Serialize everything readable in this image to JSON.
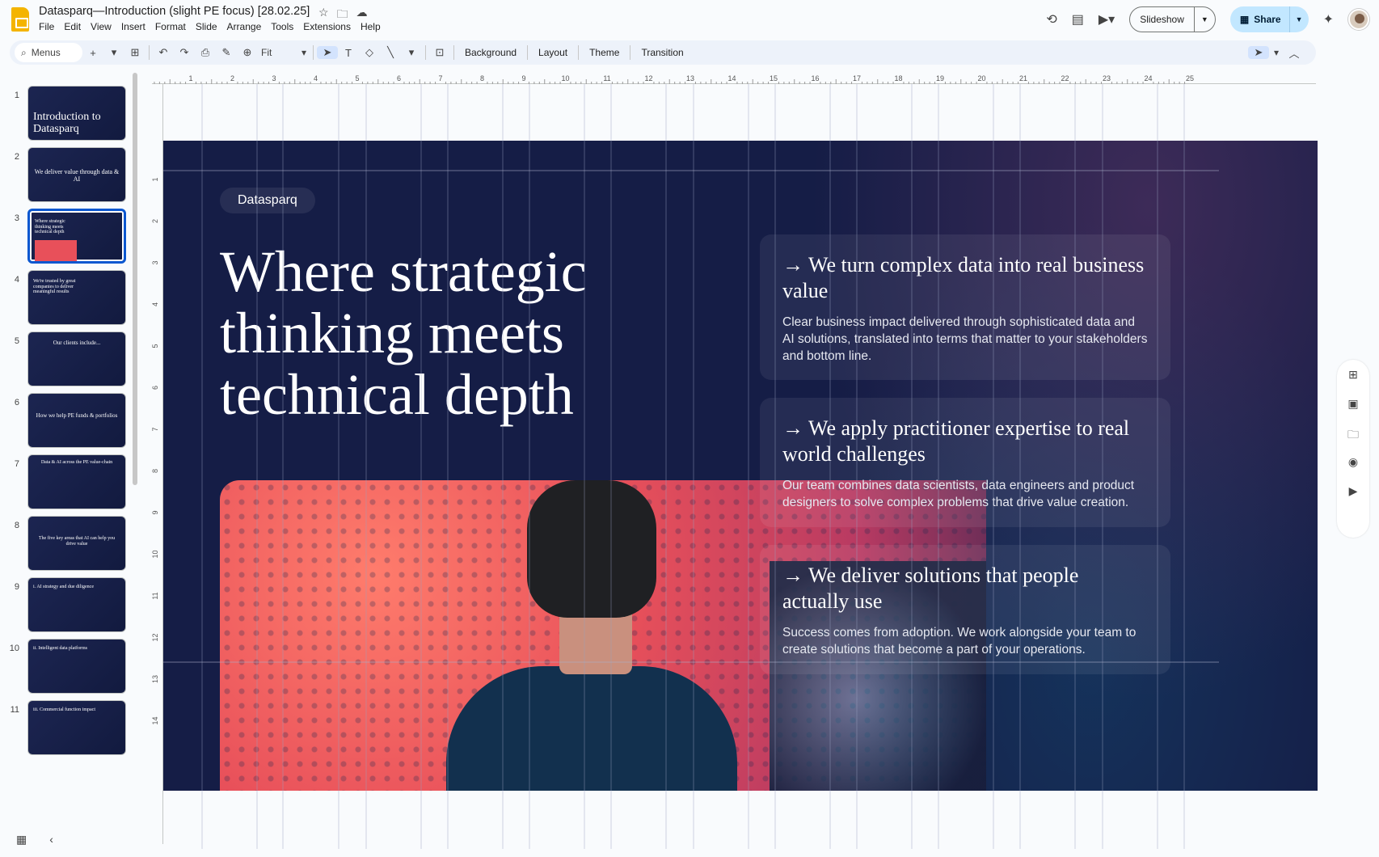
{
  "window": {
    "title": "Datasparq—Introduction (slight PE focus) [28.02.25]",
    "menus": [
      "File",
      "Edit",
      "View",
      "Insert",
      "Format",
      "Slide",
      "Arrange",
      "Tools",
      "Extensions",
      "Help"
    ],
    "slideshow_label": "Slideshow",
    "share_label": "Share"
  },
  "toolbar": {
    "search_label": "Menus",
    "zoom_value": "Fit",
    "background_label": "Background",
    "layout_label": "Layout",
    "theme_label": "Theme",
    "transition_label": "Transition"
  },
  "ruler": {
    "h_ticks": [
      "1",
      "2",
      "3",
      "4",
      "5",
      "6",
      "7",
      "8",
      "9",
      "10",
      "11",
      "12",
      "13",
      "14",
      "15",
      "16",
      "17",
      "18",
      "19",
      "20",
      "21",
      "22",
      "23",
      "24",
      "25"
    ],
    "v_ticks": [
      "1",
      "2",
      "3",
      "4",
      "5",
      "6",
      "7",
      "8",
      "9",
      "10",
      "11",
      "12",
      "13",
      "14"
    ]
  },
  "filmstrip": {
    "slides": [
      {
        "num": "1",
        "title": "Introduction to Datasparq"
      },
      {
        "num": "2",
        "title": "We deliver value through data & AI"
      },
      {
        "num": "3",
        "title": "Where strategic thinking meets technical depth"
      },
      {
        "num": "4",
        "title": "We're trusted by great companies to deliver meaningful results"
      },
      {
        "num": "5",
        "title": "Our clients include..."
      },
      {
        "num": "6",
        "title": "How we help PE funds & portfolios"
      },
      {
        "num": "7",
        "title": "Data & AI across the PE value-chain"
      },
      {
        "num": "8",
        "title": "The five key areas that AI can help you drive value"
      },
      {
        "num": "9",
        "title": "i. AI strategy and due diligence"
      },
      {
        "num": "10",
        "title": "ii. Intelligent data platforms"
      },
      {
        "num": "11",
        "title": "iii. Commercial function impact"
      }
    ],
    "selected": "3"
  },
  "slide": {
    "brand": "Datasparq",
    "headline": "Where strategic thinking meets technical depth",
    "cards": [
      {
        "title": "→ We turn complex data into real business value",
        "body": "Clear business impact delivered through sophisticated data and AI solutions, translated into terms that matter to your stakeholders and bottom line."
      },
      {
        "title": "→ We apply practitioner expertise to real world challenges",
        "body": "Our team combines data scientists, data engineers and product designers to solve complex problems that drive value creation."
      },
      {
        "title": "→ We deliver solutions that people actually use",
        "body": "Success comes from adoption. We work alongside your team to create solutions that become a part of your operations."
      }
    ]
  },
  "colors": {
    "slide_bg": "#151d46",
    "share_bg": "#c2e7ff",
    "selection": "#0b57d0",
    "app_logo": "#f4b400"
  }
}
